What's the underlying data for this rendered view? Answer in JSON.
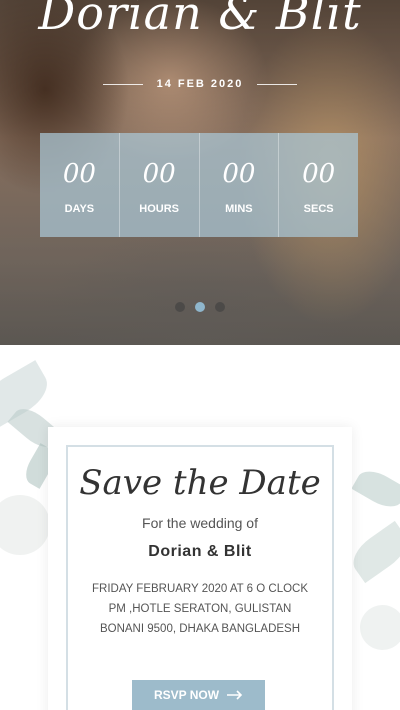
{
  "hero": {
    "couple_title": "Dorian & Blit",
    "date": "14 FEB 2020",
    "countdown": [
      {
        "value": "00",
        "label": "DAYS"
      },
      {
        "value": "00",
        "label": "HOURS"
      },
      {
        "value": "00",
        "label": "MINS"
      },
      {
        "value": "00",
        "label": "SECS"
      }
    ],
    "slider_dots": 3,
    "active_dot": 2
  },
  "save_the_date": {
    "title": "Save the Date",
    "subtitle": "For the wedding of",
    "names": "Dorian & Blit",
    "details": "FRIDAY FEBRUARY 2020 AT 6 O CLOCK PM ,HOTLE SERATON, GULISTAN BONANI 9500, DHAKA BANGLADESH",
    "rsvp_label": "RSVP NOW"
  },
  "icons": {
    "rsvp_arrow": "arrow-right-icon"
  },
  "colors": {
    "accent": "#9dbbcb",
    "countdown_bg": "#aac8d7",
    "active_dot": "#8fb6cc"
  }
}
